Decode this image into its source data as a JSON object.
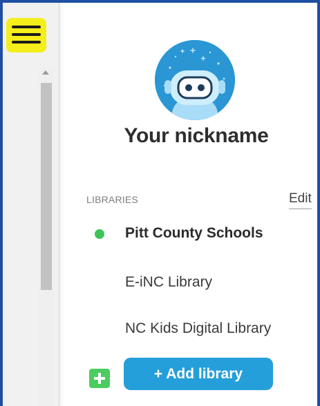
{
  "sidebar": {
    "menu_icon": "hamburger-icon",
    "highlight_color": "#f4ee1a"
  },
  "profile": {
    "avatar_icon": "robot-avatar-icon",
    "nickname": "Your nickname"
  },
  "libraries": {
    "heading": "LIBRARIES",
    "edit_label": "Edit",
    "items": [
      {
        "name": "Pitt County Schools",
        "active": true
      },
      {
        "name": "E-iNC Library",
        "active": false
      },
      {
        "name": "NC Kids Digital Library",
        "active": false
      }
    ],
    "add_label": "+ Add library",
    "add_icon": "plus-icon"
  },
  "colors": {
    "frame": "#1f4fa3",
    "accent": "#259fd9",
    "active_dot": "#3ec45a",
    "plus": "#4ccc5f"
  }
}
